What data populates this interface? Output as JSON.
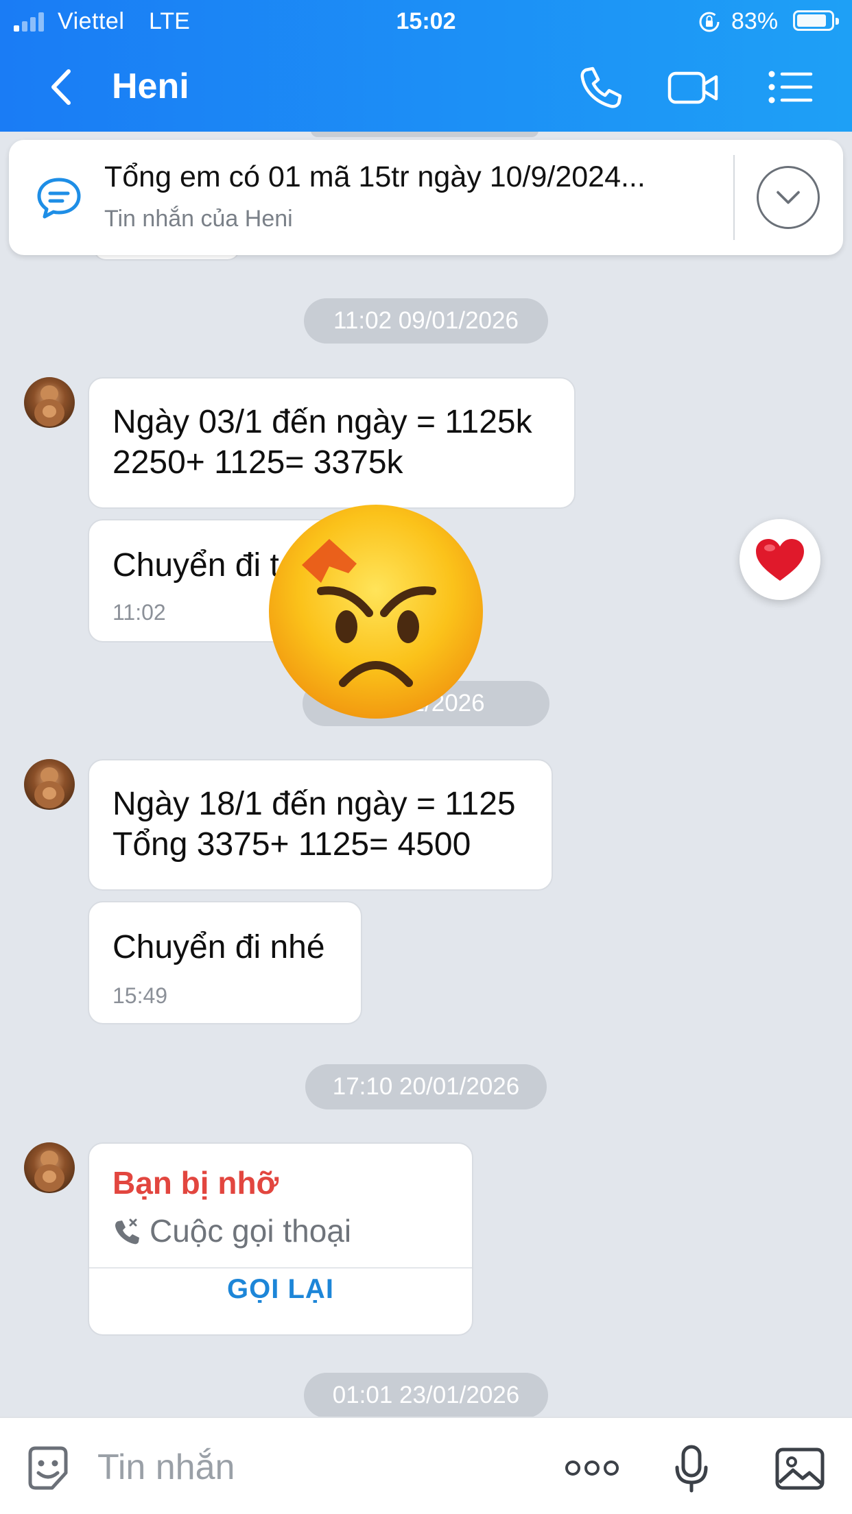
{
  "status_bar": {
    "carrier": "Viettel",
    "network": "LTE",
    "time": "15:02",
    "battery": "83%",
    "battery_level": 0.83
  },
  "header": {
    "title": "Heni",
    "icons": [
      "back-icon",
      "phone-icon",
      "video-call-icon",
      "menu-list-icon"
    ]
  },
  "pinned": {
    "text": "Tổng em có 01 mã 15tr ngày 10/9/2024...",
    "subtitle": "Tin nhắn của Heni",
    "icon": "message-icon"
  },
  "chat": {
    "date_chips": [
      "11:02 09/01/2026",
      "…/01/2026",
      "17:10 20/01/2026",
      "01:01 23/01/2026"
    ],
    "messages": [
      {
        "lines": [
          "Ngày 03/1 đến ngày = 1125k",
          "2250+ 1125= 3375k"
        ]
      },
      {
        "lines": [
          "Chuyển đi t…"
        ],
        "time": "11:02",
        "reaction": "heart-icon"
      },
      {
        "lines": [
          "Ngày 18/1 đến ngày = 1125",
          "Tổng 3375+ 1125= 4500"
        ]
      },
      {
        "lines": [
          "Chuyển đi nhé"
        ],
        "time": "15:49"
      }
    ],
    "missed_call": {
      "title": "Bạn bị nhỡ",
      "label": "Cuộc gọi thoại",
      "action": "GỌI LẠI"
    },
    "overlay_sticker": "angry-face-emoji"
  },
  "input": {
    "placeholder": "Tin nhắn",
    "icons": [
      "sticker-icon",
      "more-icon",
      "microphone-icon",
      "image-icon"
    ]
  },
  "colors": {
    "header_gradient_start": "#1a7cf5",
    "header_gradient_end": "#1ea0f6",
    "chat_background": "#e2e6ec",
    "missed_call_red": "#e2463f",
    "callback_blue": "#1d86d8"
  }
}
